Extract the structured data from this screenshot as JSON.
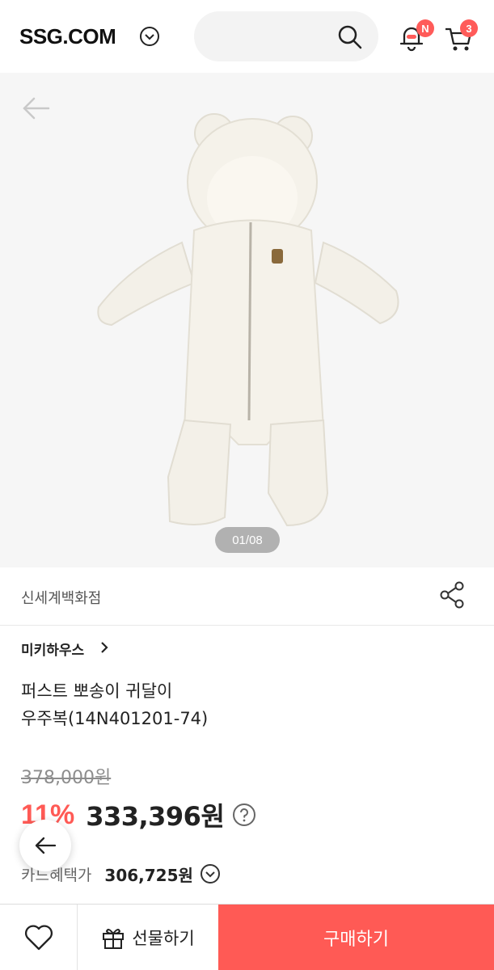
{
  "header": {
    "logo": "SSG.COM",
    "notification_badge": "N",
    "cart_count": "3"
  },
  "gallery": {
    "page_indicator": "01/08"
  },
  "store": {
    "name": "신세계백화점"
  },
  "product": {
    "brand": "미키하우스",
    "title_line1": "퍼스트 뽀송이 귀달이",
    "title_line2": "우주복(14N401201-74)",
    "original_price": "378,000원",
    "discount": "11%",
    "sale_price": "333,396원",
    "card_label": "카드혜택가",
    "card_price": "306,725원"
  },
  "actions": {
    "gift_label": "선물하기",
    "buy_label": "구매하기"
  },
  "colors": {
    "accent": "#ff5a55",
    "badge": "#ff5b59"
  }
}
